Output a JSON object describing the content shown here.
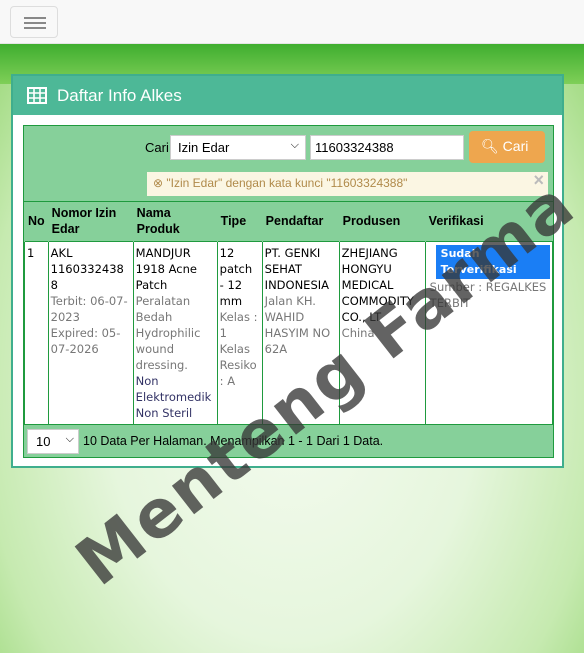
{
  "topbar": {
    "menu_icon": "hamburger-icon"
  },
  "panel": {
    "title": "Daftar Info Alkes",
    "icon": "table-icon"
  },
  "search": {
    "label": "Cari",
    "field_selected": "Izin Edar",
    "query": "11603324388",
    "button": "Cari",
    "alert": "\"Izin Edar\" dengan kata kunci \"11603324388\"",
    "alert_close": "×"
  },
  "table": {
    "headers": [
      "No",
      "Nomor Izin Edar",
      "Nama Produk",
      "Tipe",
      "Pendaftar",
      "Produsen",
      "Verifikasi"
    ],
    "rows": [
      {
        "no": "1",
        "nomor": "AKL 11603324388",
        "terbit": "Terbit: 06-07-2023",
        "expired": "Expired: 05-07-2026",
        "nama": "MANDJUR 1918 Acne Patch",
        "kategori": "Peralatan Bedah Hydrophilic wound dressing.",
        "jenis": "Non Elektromedik Non Steril",
        "tipe": "12 patch - 12 mm",
        "kelas": "Kelas : 1",
        "resiko": "Kelas Resiko : A",
        "pendaftar": "PT. GENKI SEHAT INDONESIA",
        "alamat": "Jalan KH. WAHID HASYIM NO 62A",
        "produsen": "ZHEJIANG HONGYU MEDICAL COMMODITY CO., LT",
        "negara": "China",
        "status": "Sudah Terverifikasi",
        "sumber": "Sumber : REGALKES TERBIT"
      }
    ]
  },
  "footer": {
    "per_page": "10",
    "info": "10 Data Per Halaman. Menampilkan 1 - 1 Dari 1 Data."
  },
  "watermark": "Menteng Farma",
  "colors": {
    "header": "#4db897",
    "table_green": "#86d09a",
    "button": "#eea64e",
    "badge": "#1a7ef5"
  }
}
